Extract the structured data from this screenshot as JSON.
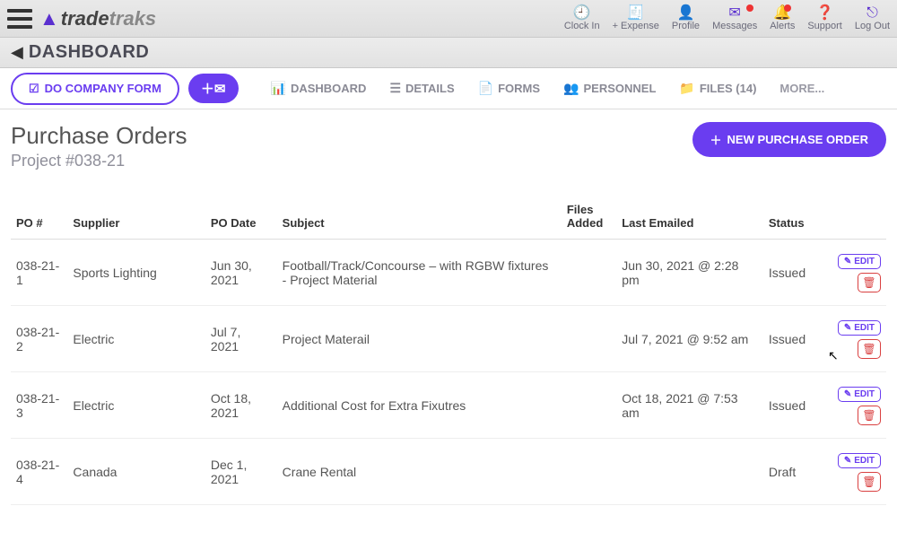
{
  "brand": {
    "mark": "▲",
    "part1": "trade",
    "part2": "traks"
  },
  "topnav": {
    "clockin": "Clock In",
    "expense": "+ Expense",
    "profile": "Profile",
    "messages": "Messages",
    "alerts": "Alerts",
    "support": "Support",
    "logout": "Log Out"
  },
  "breadcrumb": "DASHBOARD",
  "tabs": {
    "company_form": "DO COMPANY FORM",
    "dashboard": "DASHBOARD",
    "details": "DETAILS",
    "forms": "FORMS",
    "personnel": "PERSONNEL",
    "files": "FILES (14)",
    "more": "MORE..."
  },
  "page": {
    "title": "Purchase Orders",
    "subtitle": "Project #038-21",
    "new_btn": "NEW PURCHASE ORDER"
  },
  "columns": {
    "po": "PO #",
    "supplier": "Supplier",
    "podate": "PO Date",
    "subject": "Subject",
    "files": "Files Added",
    "emailed": "Last Emailed",
    "status": "Status"
  },
  "rows": [
    {
      "po": "038-21-1",
      "supplier": "Sports Lighting",
      "podate": "Jun 30, 2021",
      "subject": "Football/Track/Concourse – with RGBW fixtures - Project Material",
      "files": "",
      "emailed": "Jun 30, 2021 @ 2:28 pm",
      "status": "Issued"
    },
    {
      "po": "038-21-2",
      "supplier": "Electric",
      "podate": "Jul 7, 2021",
      "subject": "Project Materail",
      "files": "",
      "emailed": "Jul 7, 2021 @ 9:52 am",
      "status": "Issued"
    },
    {
      "po": "038-21-3",
      "supplier": "Electric",
      "podate": "Oct 18, 2021",
      "subject": "Additional Cost for Extra Fixutres",
      "files": "",
      "emailed": "Oct 18, 2021 @ 7:53 am",
      "status": "Issued"
    },
    {
      "po": "038-21-4",
      "supplier": "Canada",
      "podate": "Dec 1, 2021",
      "subject": "Crane Rental",
      "files": "",
      "emailed": "",
      "status": "Draft"
    }
  ],
  "actions": {
    "edit": "EDIT"
  }
}
